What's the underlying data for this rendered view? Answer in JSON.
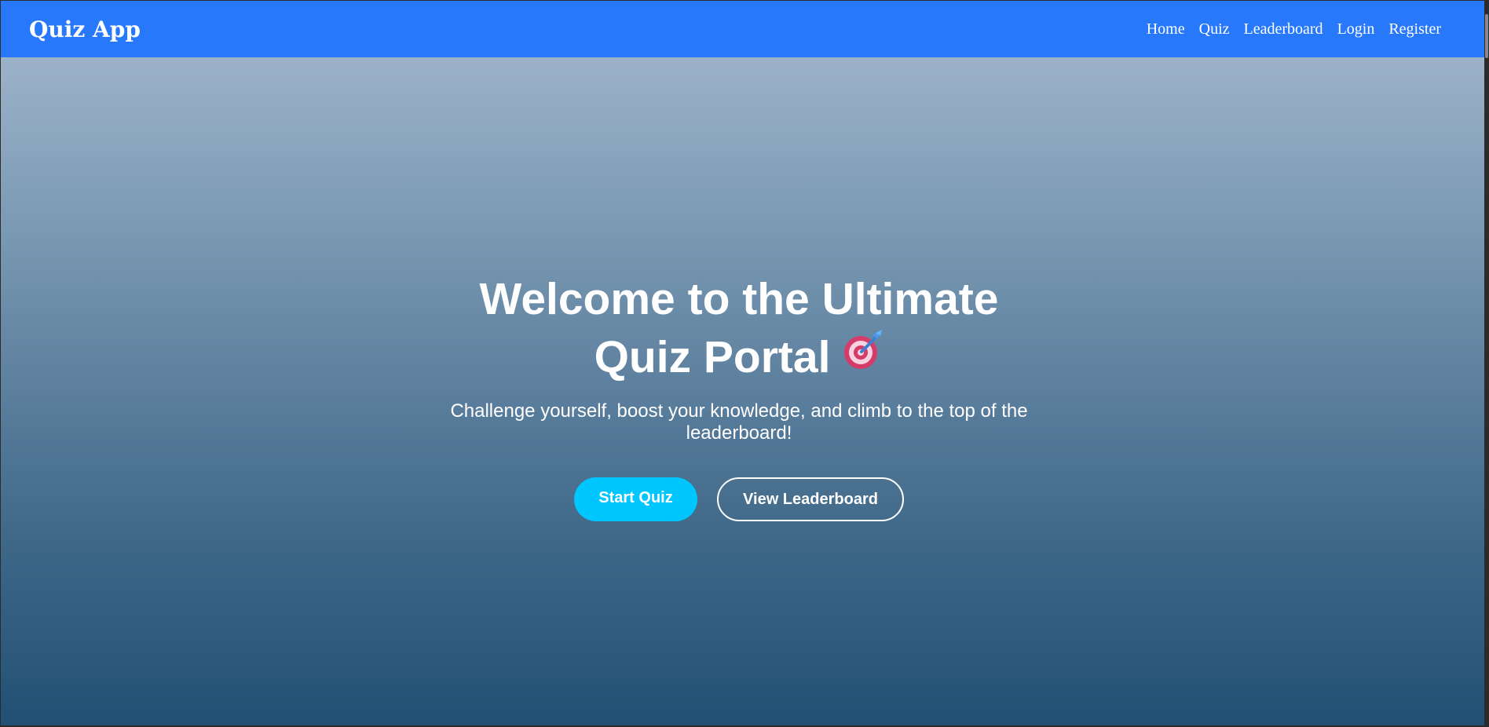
{
  "app": {
    "brand": "Quiz App",
    "accent_color": "#2878fc"
  },
  "nav": {
    "items": [
      {
        "label": "Home"
      },
      {
        "label": "Quiz"
      },
      {
        "label": "Leaderboard"
      },
      {
        "label": "Login"
      },
      {
        "label": "Register"
      }
    ]
  },
  "hero": {
    "title": "Welcome to the Ultimate Quiz Portal",
    "title_icon": "target-icon",
    "subtitle": "Challenge yourself, boost your knowledge, and climb to the top of the leaderboard!",
    "primary_button": "Start Quiz",
    "secondary_button": "View Leaderboard",
    "primary_button_color": "#00c6ff"
  }
}
